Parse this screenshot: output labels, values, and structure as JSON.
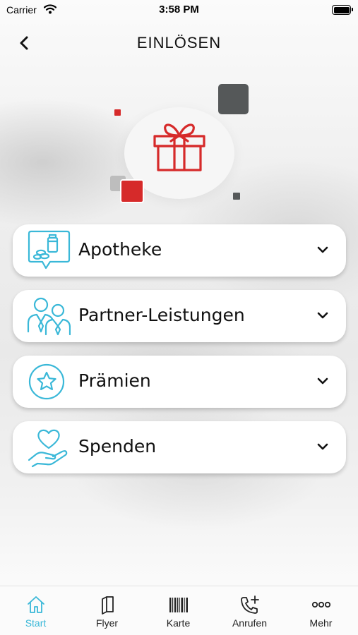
{
  "status_bar": {
    "carrier": "Carrier",
    "time": "3:58 PM"
  },
  "header": {
    "title": "EINLÖSEN",
    "back_icon": "chevron-left-icon"
  },
  "hero": {
    "icon": "gift-icon",
    "accent_red": "#d62a2a",
    "accent_dark": "#555859"
  },
  "menu": {
    "items": [
      {
        "label": "Apotheke",
        "icon": "pharmacy-chat-icon"
      },
      {
        "label": "Partner-Leistungen",
        "icon": "partners-icon"
      },
      {
        "label": "Prämien",
        "icon": "star-circle-icon"
      },
      {
        "label": "Spenden",
        "icon": "heart-hand-icon"
      }
    ],
    "icon_color": "#3ab8d8"
  },
  "tab_bar": {
    "tabs": [
      {
        "label": "Start",
        "icon": "home-icon",
        "active": true
      },
      {
        "label": "Flyer",
        "icon": "flyer-icon",
        "active": false
      },
      {
        "label": "Karte",
        "icon": "barcode-icon",
        "active": false
      },
      {
        "label": "Anrufen",
        "icon": "phone-plus-icon",
        "active": false
      },
      {
        "label": "Mehr",
        "icon": "more-icon",
        "active": false
      }
    ],
    "active_color": "#3ab8d8"
  }
}
